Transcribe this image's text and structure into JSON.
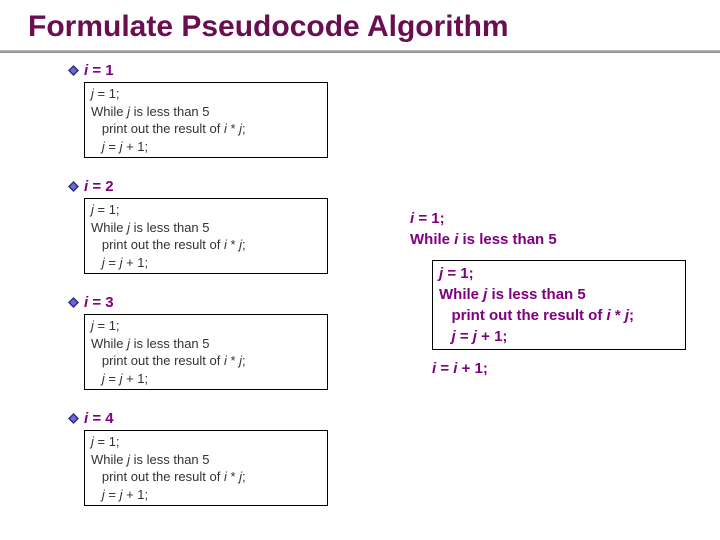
{
  "title": "Formulate Pseudocode Algorithm",
  "left": {
    "items": [
      {
        "header_html": "<i>i</i> = 1",
        "code": [
          "<i>j</i> = 1;",
          "While <i>j</i> is less than 5",
          "   print out the result of <i>i</i> * <i>j</i>;",
          "   <i>j</i> = <i>j</i> + 1;"
        ]
      },
      {
        "header_html": "<i>i</i> = 2",
        "code": [
          "<i>j</i> = 1;",
          "While <i>j</i> is less than 5",
          "   print out the result of <i>i</i> * <i>j</i>;",
          "   <i>j</i> = <i>j</i> + 1;"
        ]
      },
      {
        "header_html": "<i>i</i> = 3",
        "code": [
          "<i>j</i> = 1;",
          "While <i>j</i> is less than 5",
          "   print out the result of <i>i</i> * <i>j</i>;",
          "   <i>j</i> = <i>j</i> + 1;"
        ]
      },
      {
        "header_html": "<i>i</i> = 4",
        "code": [
          "<i>j</i> = 1;",
          "While <i>j</i> is less than 5",
          "   print out the result of <i>i</i> * <i>j</i>;",
          "   <i>j</i> = <i>j</i> + 1;"
        ]
      }
    ]
  },
  "right": {
    "pre": [
      "<i>i</i> = 1;",
      "While <i>i</i> is less than 5"
    ],
    "inner": [
      "<i>j</i> = 1;",
      "While <i>j</i> is less than 5",
      "   print out the result of <i>i</i> * <i>j</i>;",
      "   <i>j</i> = <i>j</i> + 1;"
    ],
    "post": [
      "<i>i</i> = <i>i</i> + 1;"
    ]
  }
}
